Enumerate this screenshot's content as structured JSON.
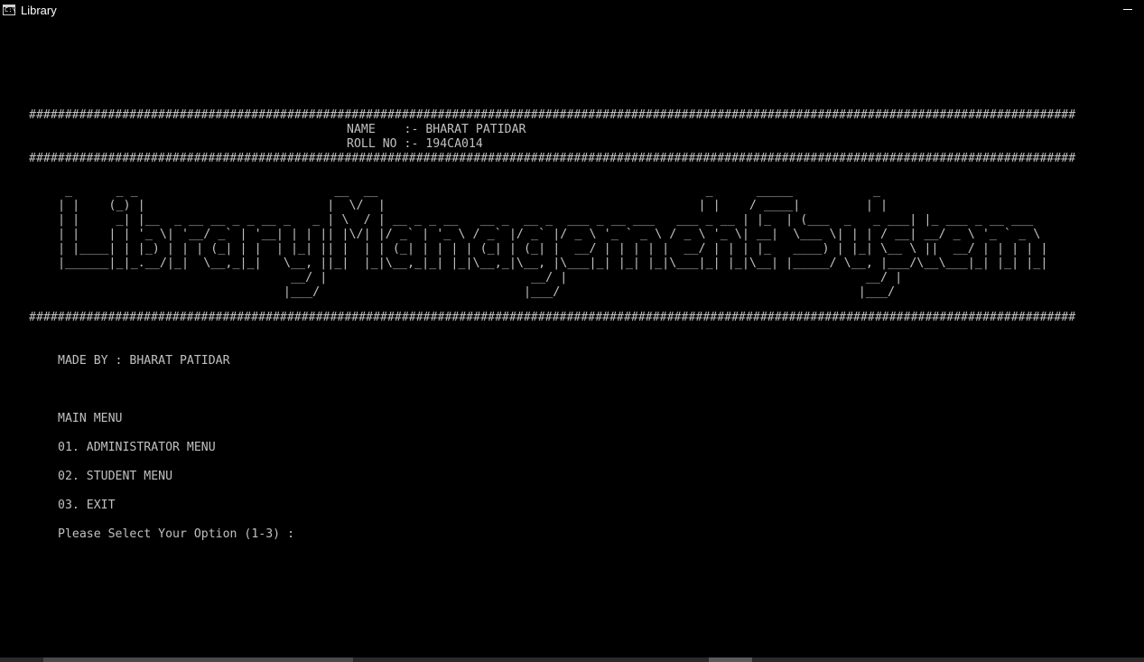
{
  "window": {
    "icon_glyph": "C:\\",
    "title": "Library"
  },
  "console": {
    "hash_rule": "##################################################################################################################################################",
    "name_line": "NAME    :- BHARAT PATIDAR",
    "roll_line": "ROLL NO :- 194CA014",
    "ascii_banner": " _      _ _                           __  __                                             _      _____           _                 \n| |    (_) |                         |  \\/  |                                           | |    / ____|         | |                \n| |     _| |__  _ __ __ _ _ __ _   _ | \\  / | __ _ _ __   __ _  __ _  ___ _ __ ___   ___ _ __ | |_  | (___  _   _ ___| |_ ___ _ __ ___ \n| |    | | '_ \\| '__/ _` | '__| | | || |\\/| |/ _` | '_ \\ / _` |/ _` |/ _ \\ '_ ` _ \\ / _ \\ '_ \\| __|  \\___ \\| | | / __| __/ _ \\ '_ ` _ \\\n| |____| | |_) | | | (_| | |  | |_| || |  | | (_| | | | | (_| | (_| |  __/ | | | | |  __/ | | | |_   ____) | |_| \\__ \\ ||  __/ | | | | |\n|______|_|_.__/|_|  \\__,_|_|   \\__, ||_|  |_|\\__,_|_| |_|\\__,_|\\__, |\\___|_| |_| |_|\\___|_| |_|\\__| |_____/ \\__, |___/\\__\\___|_| |_| |_|\n                                __/ |                            __/ |                                         __/ |                \n                               |___/                            |___/                                         |___/                 ",
    "made_by": "MADE BY : BHARAT PATIDAR",
    "menu_title": "MAIN MENU",
    "menu_items": [
      "01. ADMINISTRATOR MENU",
      "02. STUDENT MENU",
      "03. EXIT"
    ],
    "prompt": "Please Select Your Option (1-3) : "
  }
}
